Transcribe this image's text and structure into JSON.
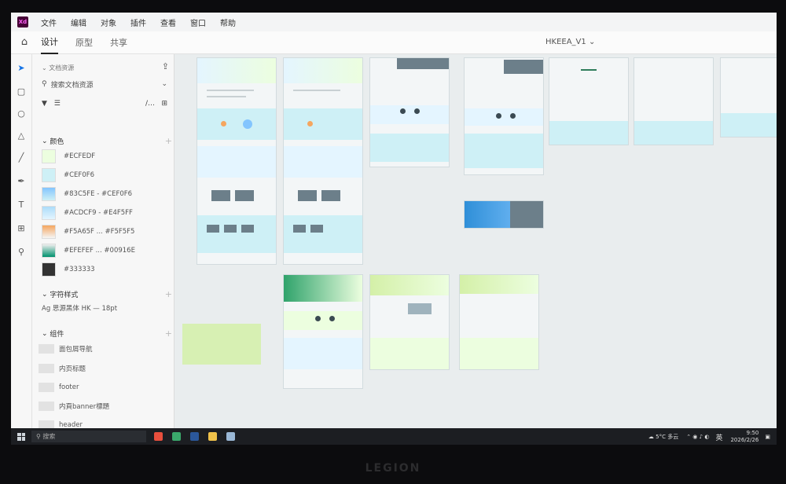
{
  "app": {
    "logo": "Xd",
    "document": "HKEEA_V1"
  },
  "menu": [
    "文件",
    "编辑",
    "对象",
    "插件",
    "查看",
    "窗口",
    "帮助"
  ],
  "modes": [
    "设计",
    "原型",
    "共享"
  ],
  "panel": {
    "title": "文档资源",
    "search_placeholder": "搜索文档资源",
    "colors_heading": "颜色",
    "colors": [
      {
        "label": "#ECFEDF",
        "swatch": "#ECFEDF"
      },
      {
        "label": "#CEF0F6",
        "swatch": "#CEF0F6"
      },
      {
        "label": "#83C5FE - #CEF0F6",
        "swatch": "#83C5FE"
      },
      {
        "label": "#ACDCF9 - #E4F5FF",
        "swatch": "#ACDCF9"
      },
      {
        "label": "#F5A65F ... #F5F5F5",
        "swatch": "#F5A65F"
      },
      {
        "label": "#EFEFEF ... #00916E",
        "swatch": "#00916E"
      },
      {
        "label": "#333333",
        "swatch": "#333333"
      }
    ],
    "char_heading": "字符样式",
    "char_style": "Ag  思源黑体 HK — 18pt",
    "components_heading": "组件",
    "components": [
      "面包屑导航",
      "内页标题",
      "footer",
      "内頁banner標題",
      "header"
    ]
  },
  "taskbar": {
    "search_placeholder": "搜索",
    "weather": "5°C 多云",
    "ime": "英",
    "time": "9:50",
    "date": "2026/2/26"
  },
  "brand": "LEGION"
}
